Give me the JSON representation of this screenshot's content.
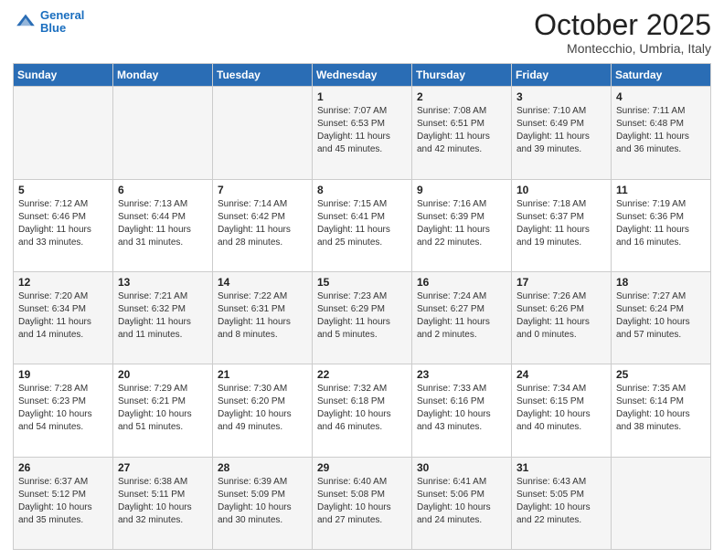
{
  "header": {
    "logo_line1": "General",
    "logo_line2": "Blue",
    "month": "October 2025",
    "location": "Montecchio, Umbria, Italy"
  },
  "weekdays": [
    "Sunday",
    "Monday",
    "Tuesday",
    "Wednesday",
    "Thursday",
    "Friday",
    "Saturday"
  ],
  "weeks": [
    [
      {
        "day": "",
        "info": ""
      },
      {
        "day": "",
        "info": ""
      },
      {
        "day": "",
        "info": ""
      },
      {
        "day": "1",
        "info": "Sunrise: 7:07 AM\nSunset: 6:53 PM\nDaylight: 11 hours\nand 45 minutes."
      },
      {
        "day": "2",
        "info": "Sunrise: 7:08 AM\nSunset: 6:51 PM\nDaylight: 11 hours\nand 42 minutes."
      },
      {
        "day": "3",
        "info": "Sunrise: 7:10 AM\nSunset: 6:49 PM\nDaylight: 11 hours\nand 39 minutes."
      },
      {
        "day": "4",
        "info": "Sunrise: 7:11 AM\nSunset: 6:48 PM\nDaylight: 11 hours\nand 36 minutes."
      }
    ],
    [
      {
        "day": "5",
        "info": "Sunrise: 7:12 AM\nSunset: 6:46 PM\nDaylight: 11 hours\nand 33 minutes."
      },
      {
        "day": "6",
        "info": "Sunrise: 7:13 AM\nSunset: 6:44 PM\nDaylight: 11 hours\nand 31 minutes."
      },
      {
        "day": "7",
        "info": "Sunrise: 7:14 AM\nSunset: 6:42 PM\nDaylight: 11 hours\nand 28 minutes."
      },
      {
        "day": "8",
        "info": "Sunrise: 7:15 AM\nSunset: 6:41 PM\nDaylight: 11 hours\nand 25 minutes."
      },
      {
        "day": "9",
        "info": "Sunrise: 7:16 AM\nSunset: 6:39 PM\nDaylight: 11 hours\nand 22 minutes."
      },
      {
        "day": "10",
        "info": "Sunrise: 7:18 AM\nSunset: 6:37 PM\nDaylight: 11 hours\nand 19 minutes."
      },
      {
        "day": "11",
        "info": "Sunrise: 7:19 AM\nSunset: 6:36 PM\nDaylight: 11 hours\nand 16 minutes."
      }
    ],
    [
      {
        "day": "12",
        "info": "Sunrise: 7:20 AM\nSunset: 6:34 PM\nDaylight: 11 hours\nand 14 minutes."
      },
      {
        "day": "13",
        "info": "Sunrise: 7:21 AM\nSunset: 6:32 PM\nDaylight: 11 hours\nand 11 minutes."
      },
      {
        "day": "14",
        "info": "Sunrise: 7:22 AM\nSunset: 6:31 PM\nDaylight: 11 hours\nand 8 minutes."
      },
      {
        "day": "15",
        "info": "Sunrise: 7:23 AM\nSunset: 6:29 PM\nDaylight: 11 hours\nand 5 minutes."
      },
      {
        "day": "16",
        "info": "Sunrise: 7:24 AM\nSunset: 6:27 PM\nDaylight: 11 hours\nand 2 minutes."
      },
      {
        "day": "17",
        "info": "Sunrise: 7:26 AM\nSunset: 6:26 PM\nDaylight: 11 hours\nand 0 minutes."
      },
      {
        "day": "18",
        "info": "Sunrise: 7:27 AM\nSunset: 6:24 PM\nDaylight: 10 hours\nand 57 minutes."
      }
    ],
    [
      {
        "day": "19",
        "info": "Sunrise: 7:28 AM\nSunset: 6:23 PM\nDaylight: 10 hours\nand 54 minutes."
      },
      {
        "day": "20",
        "info": "Sunrise: 7:29 AM\nSunset: 6:21 PM\nDaylight: 10 hours\nand 51 minutes."
      },
      {
        "day": "21",
        "info": "Sunrise: 7:30 AM\nSunset: 6:20 PM\nDaylight: 10 hours\nand 49 minutes."
      },
      {
        "day": "22",
        "info": "Sunrise: 7:32 AM\nSunset: 6:18 PM\nDaylight: 10 hours\nand 46 minutes."
      },
      {
        "day": "23",
        "info": "Sunrise: 7:33 AM\nSunset: 6:16 PM\nDaylight: 10 hours\nand 43 minutes."
      },
      {
        "day": "24",
        "info": "Sunrise: 7:34 AM\nSunset: 6:15 PM\nDaylight: 10 hours\nand 40 minutes."
      },
      {
        "day": "25",
        "info": "Sunrise: 7:35 AM\nSunset: 6:14 PM\nDaylight: 10 hours\nand 38 minutes."
      }
    ],
    [
      {
        "day": "26",
        "info": "Sunrise: 6:37 AM\nSunset: 5:12 PM\nDaylight: 10 hours\nand 35 minutes."
      },
      {
        "day": "27",
        "info": "Sunrise: 6:38 AM\nSunset: 5:11 PM\nDaylight: 10 hours\nand 32 minutes."
      },
      {
        "day": "28",
        "info": "Sunrise: 6:39 AM\nSunset: 5:09 PM\nDaylight: 10 hours\nand 30 minutes."
      },
      {
        "day": "29",
        "info": "Sunrise: 6:40 AM\nSunset: 5:08 PM\nDaylight: 10 hours\nand 27 minutes."
      },
      {
        "day": "30",
        "info": "Sunrise: 6:41 AM\nSunset: 5:06 PM\nDaylight: 10 hours\nand 24 minutes."
      },
      {
        "day": "31",
        "info": "Sunrise: 6:43 AM\nSunset: 5:05 PM\nDaylight: 10 hours\nand 22 minutes."
      },
      {
        "day": "",
        "info": ""
      }
    ]
  ]
}
